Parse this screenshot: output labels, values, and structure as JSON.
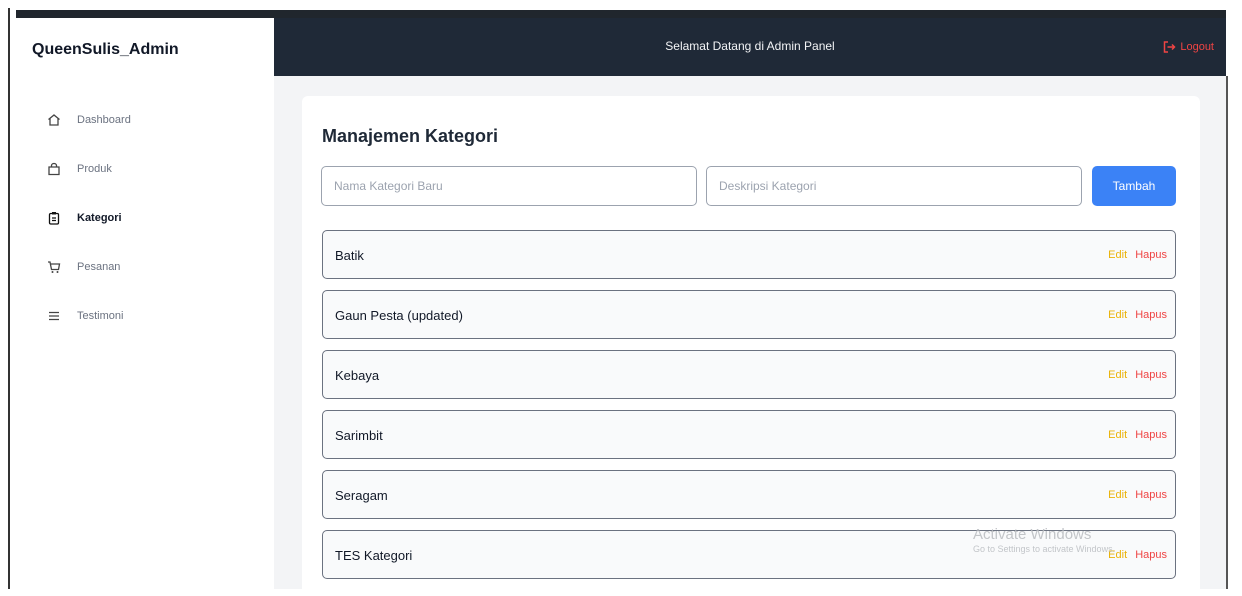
{
  "app": {
    "brand": "QueenSulis_Admin",
    "header_title": "Selamat Datang di Admin Panel",
    "logout_label": "Logout"
  },
  "sidebar": {
    "items": [
      {
        "label": "Dashboard",
        "icon": "home-icon",
        "active": false
      },
      {
        "label": "Produk",
        "icon": "bag-icon",
        "active": false
      },
      {
        "label": "Kategori",
        "icon": "clipboard-icon",
        "active": true
      },
      {
        "label": "Pesanan",
        "icon": "cart-icon",
        "active": false
      },
      {
        "label": "Testimoni",
        "icon": "menu-lines-icon",
        "active": false
      }
    ]
  },
  "main": {
    "page_title": "Manajemen Kategori",
    "form": {
      "name_placeholder": "Nama Kategori Baru",
      "name_value": "",
      "desc_placeholder": "Deskripsi Kategori",
      "desc_value": "",
      "add_label": "Tambah"
    },
    "categories": [
      {
        "name": "Batik",
        "edit": "Edit",
        "delete": "Hapus"
      },
      {
        "name": "Gaun Pesta (updated)",
        "edit": "Edit",
        "delete": "Hapus"
      },
      {
        "name": "Kebaya",
        "edit": "Edit",
        "delete": "Hapus"
      },
      {
        "name": "Sarimbit",
        "edit": "Edit",
        "delete": "Hapus"
      },
      {
        "name": "Seragam",
        "edit": "Edit",
        "delete": "Hapus"
      },
      {
        "name": "TES Kategori",
        "edit": "Edit",
        "delete": "Hapus"
      }
    ]
  },
  "overlay": {
    "watermark_title": "Activate Windows",
    "watermark_sub": "Go to Settings to activate Windows."
  },
  "colors": {
    "sidebar_bg": "#ffffff",
    "topbar_bg": "#1f2937",
    "accent_blue": "#3b82f6",
    "edit_yellow": "#eab308",
    "delete_red": "#ef4444"
  }
}
